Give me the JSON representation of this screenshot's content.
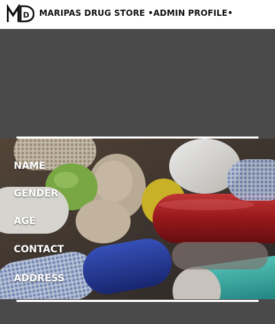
{
  "header": {
    "logo_alt": "MD",
    "title": "MARIPAS DRUG STORE •ADMIN PROFILE•"
  },
  "profile": {
    "fields": [
      {
        "label": "NAME"
      },
      {
        "label": "GENDER"
      },
      {
        "label": "AGE"
      },
      {
        "label": "CONTACT"
      },
      {
        "label": "ADDRESS"
      }
    ]
  },
  "colors": {
    "header_bg": "#ffffff",
    "page_bg": "#494949",
    "rule": "#ffffff",
    "label_text": "#ffffff"
  }
}
